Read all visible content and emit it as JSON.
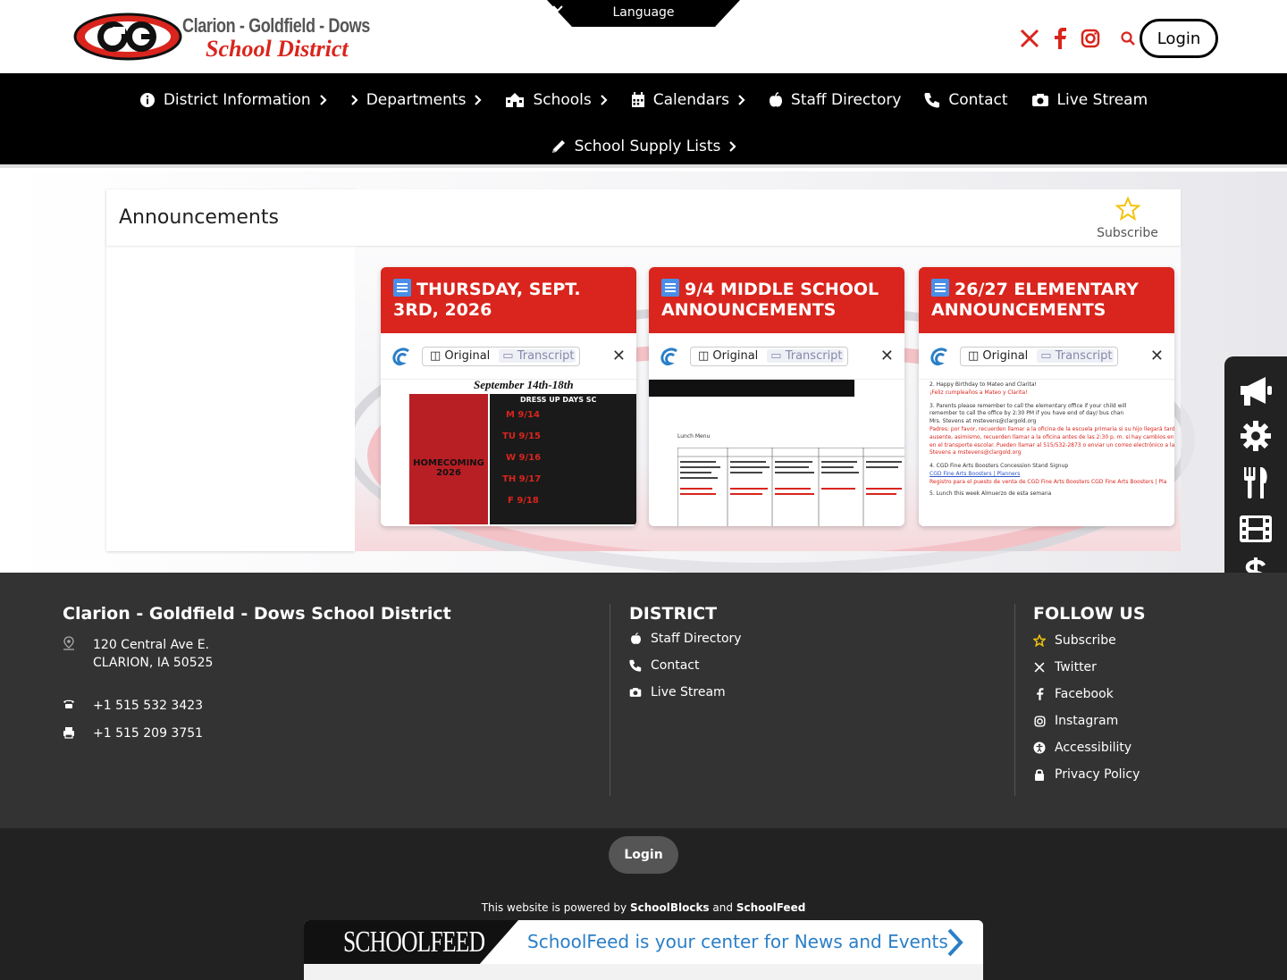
{
  "header": {
    "logo_line1": "Clarion - Goldfield - Dows",
    "logo_line2": "School District",
    "language_label": "Language",
    "login_label": "Login",
    "social_icons": [
      "x-icon",
      "facebook-icon",
      "instagram-icon",
      "search-icon"
    ]
  },
  "nav": {
    "row1": [
      {
        "label": "District Information",
        "icon": "info-icon"
      },
      {
        "label": "Departments",
        "icon": "chevron-right-icon"
      },
      {
        "label": "Schools",
        "icon": "school-icon"
      },
      {
        "label": "Calendars",
        "icon": "calendar-icon"
      },
      {
        "label": "Staff Directory",
        "icon": "apple-icon"
      },
      {
        "label": "Contact",
        "icon": "phone-icon"
      },
      {
        "label": "Live Stream",
        "icon": "camera-icon"
      }
    ],
    "row2": [
      {
        "label": "School Supply Lists",
        "icon": "pencil-icon"
      }
    ]
  },
  "announcements": {
    "title": "Announcements",
    "subscribe_label": "Subscribe",
    "cards": [
      {
        "title": "THURSDAY, SEPT. 3RD, 2026",
        "original_label": "Original",
        "transcript_label": "Transcript",
        "preview": {
          "heading": "September 14th-18th",
          "subheading": "DRESS UP DAYS SC",
          "poster_text": "HOMECOMING 2026",
          "days": [
            "M 9/14",
            "TU 9/15",
            "W 9/16",
            "TH 9/17",
            "F 9/18"
          ]
        }
      },
      {
        "title": "9/4 MIDDLE SCHOOL ANNOUNCEMENTS",
        "original_label": "Original",
        "transcript_label": "Transcript",
        "preview": {
          "menu_label": "Lunch Menu"
        }
      },
      {
        "title": "26/27 ELEMENTARY ANNOUNCEMENTS",
        "original_label": "Original",
        "transcript_label": "Transcript",
        "preview": {
          "lines": [
            "2. Happy Birthday to Mateo and Clarita!",
            "¡Feliz cumpleaños a Mateo y Clarita!",
            "3. Parents please remember to call the elementary office if your child will",
            "remember to call the office by 2:30 PM if you have end of day/ bus chan",
            "Mrs. Stevens at mstevens@clargold.org",
            "Padres: por favor, recuerden llamar a la oficina de la escuela primaria si su hijo llegará tarde",
            "ausente, asimismo, recuerden llamar a la oficina antes de las 2:30 p. m. si hay cambios en",
            "en el transporte escolar. Pueden llamar al 515/532-2873 o enviar un correo electrónico a la",
            "Stevens a mstevens@clargold.org",
            "4. CGD Fine Arts Boosters Concession Stand Signup",
            "CGD Fine Arts Boosters | Planners",
            "Registro para el puesto de venta de CGD Fine Arts Boosters CGD Fine Arts Boosters | Pla",
            "5. Lunch this week Almuerzo de esta semana"
          ]
        }
      }
    ]
  },
  "side_toolbar": [
    "megaphone-icon",
    "gear-icon",
    "utensils-icon",
    "film-icon",
    "dollar-icon"
  ],
  "footer": {
    "district_name": "Clarion - Goldfield - Dows School District",
    "address1": "120 Central Ave E.",
    "address2": "CLARION, IA 50525",
    "phone": "+1 515 532 3423",
    "fax": "+1 515 209 3751",
    "district_heading": "DISTRICT",
    "district_links": [
      {
        "label": "Staff Directory",
        "icon": "apple-icon"
      },
      {
        "label": "Contact",
        "icon": "phone-icon"
      },
      {
        "label": "Live Stream",
        "icon": "camera-icon"
      }
    ],
    "follow_heading": "FOLLOW US",
    "follow_links": [
      {
        "label": "Subscribe",
        "icon": "star-icon"
      },
      {
        "label": "Twitter",
        "icon": "x-icon"
      },
      {
        "label": "Facebook",
        "icon": "facebook-icon"
      },
      {
        "label": "Instagram",
        "icon": "instagram-icon"
      },
      {
        "label": "Accessibility",
        "icon": "accessibility-icon"
      },
      {
        "label": "Privacy Policy",
        "icon": "lock-icon"
      }
    ]
  },
  "bottom": {
    "login_label": "Login",
    "powered_prefix": "This website is powered by",
    "powered_brand1": "SchoolBlocks",
    "powered_and": "and",
    "powered_brand2": "SchoolFeed",
    "banner_logo": "SCHOOLFEED",
    "banner_text": "SchoolFeed is your center for News and Events"
  },
  "colors": {
    "brand_red": "#d9251d",
    "nav_bg": "#000000",
    "footer_bg": "#333333",
    "bottom_bg": "#222222",
    "link_blue": "#2a7fc7",
    "star_yellow": "#f2c40f"
  }
}
